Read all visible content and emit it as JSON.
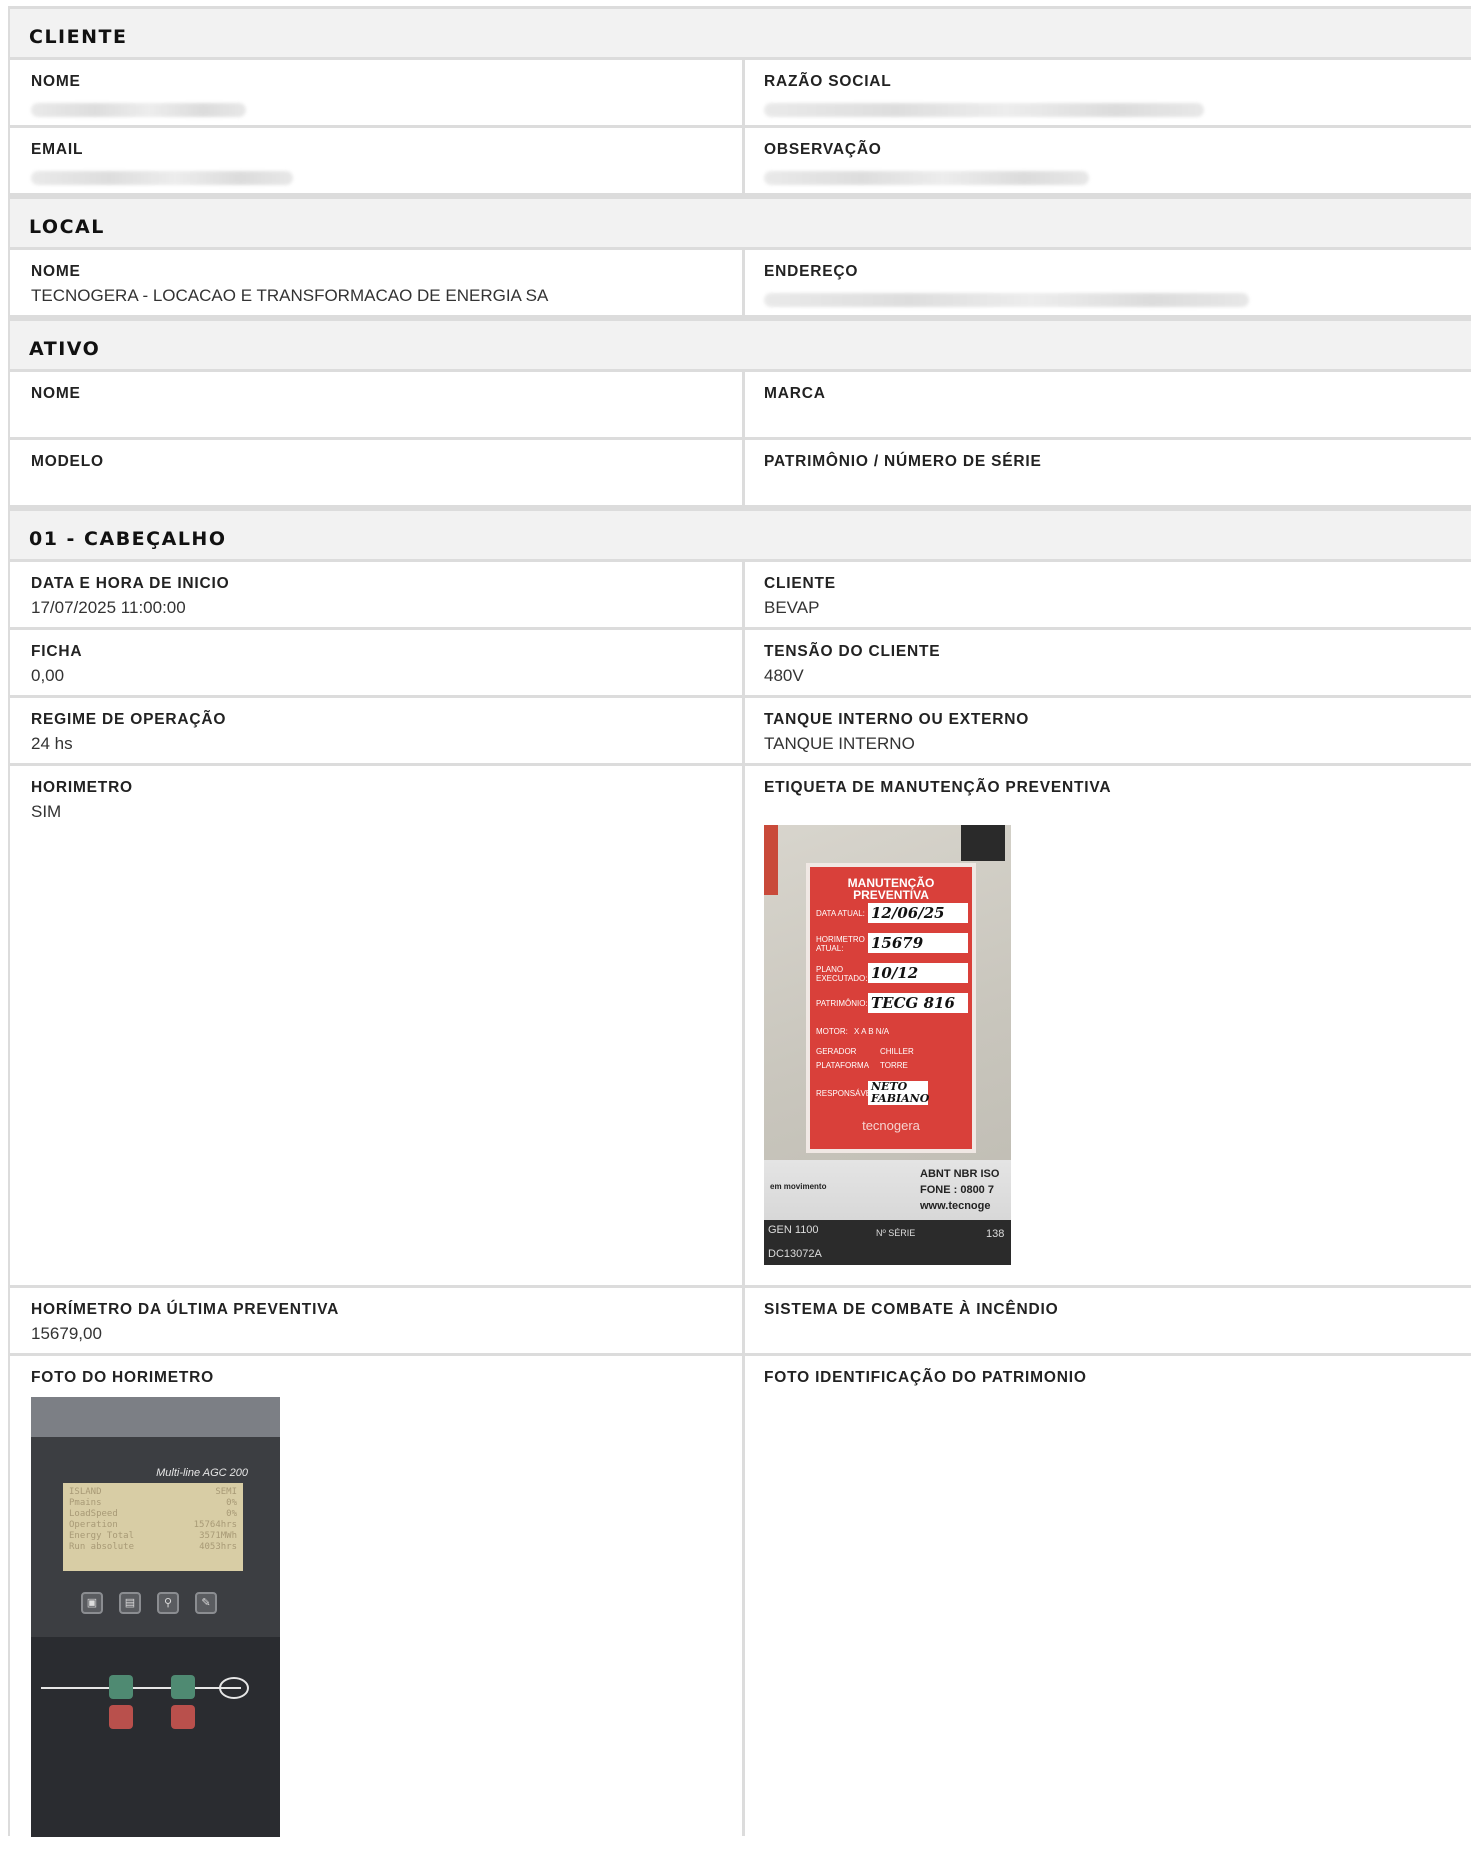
{
  "sections": {
    "cliente": {
      "title": "CLIENTE",
      "nome_label": "NOME",
      "razao_label": "RAZÃO SOCIAL",
      "email_label": "EMAIL",
      "observacao_label": "OBSERVAÇÃO"
    },
    "local": {
      "title": "LOCAL",
      "nome_label": "NOME",
      "nome_value": "TECNOGERA - LOCACAO E TRANSFORMACAO DE ENERGIA SA",
      "endereco_label": "ENDEREÇO"
    },
    "ativo": {
      "title": "ATIVO",
      "nome_label": "NOME",
      "marca_label": "MARCA",
      "modelo_label": "MODELO",
      "patrimonio_label": "PATRIMÔNIO / NÚMERO DE SÉRIE"
    },
    "cabecalho": {
      "title": "01 - CABEÇALHO",
      "data_label": "DATA E HORA DE INICIO",
      "data_value": "17/07/2025 11:00:00",
      "cliente_label": "CLIENTE",
      "cliente_value": "BEVAP",
      "ficha_label": "FICHA",
      "ficha_value": "0,00",
      "tensao_label": "TENSÃO DO CLIENTE",
      "tensao_value": "480V",
      "regime_label": "REGIME DE OPERAÇÃO",
      "regime_value": "24 hs",
      "tanque_label": "TANQUE INTERNO OU EXTERNO",
      "tanque_value": "TANQUE INTERNO",
      "horimetro_label": "HORIMETRO",
      "horimetro_value": "SIM",
      "etiqueta_label": "ETIQUETA DE MANUTENÇÃO PREVENTIVA",
      "horimetro_ultima_label": "HORÍMETRO DA ÚLTIMA PREVENTIVA",
      "horimetro_ultima_value": "15679,00",
      "sistema_label": "SISTEMA DE COMBATE À INCÊNDIO",
      "foto_horimetro_label": "FOTO DO HORIMETRO",
      "foto_patrimonio_label": "FOTO IDENTIFICAÇÃO DO PATRIMONIO"
    }
  },
  "tag_photo": {
    "title": "MANUTENÇÃO PREVENTIVA",
    "data_atual_label": "DATA ATUAL:",
    "data_atual": "12/06/25",
    "horimetro_label": "HORIMETRO ATUAL:",
    "horimetro": "15679",
    "plano_label": "PLANO EXECUTADO:",
    "plano": "10/12",
    "patrimonio_label": "PATRIMÔNIO:",
    "patrimonio": "TECG 816",
    "motor_label": "MOTOR:",
    "motor_opts": "X A   B   N/A",
    "gerador": "GERADOR",
    "chiller": "CHILLER",
    "plataforma": "PLATAFORMA",
    "torre": "TORRE",
    "responsavel_label": "RESPONSÁVEL:",
    "responsavel": "NETO FABIANO",
    "brand": "tecnogera",
    "plate_norm": "ABNT NBR ISO",
    "plate_fone": "FONE : 0800 7",
    "plate_site": "www.tecnoge",
    "plate_slogan": "em movimento",
    "plate_model": "GEN 1100",
    "plate_serie": "Nº SÉRIE",
    "plate_serie_val": "138",
    "plate_code": "DC13072A"
  },
  "hm_photo": {
    "brand": "Multi-line AGC 200",
    "lcd_rows": [
      [
        "ISLAND",
        "SEMI"
      ],
      [
        "Pmains",
        "0%"
      ],
      [
        "LoadSpeed",
        "0%"
      ],
      [
        "Operation",
        "15764hrs"
      ],
      [
        "Energy Total",
        "3571MWh"
      ],
      [
        "Run absolute",
        "4053hrs"
      ]
    ]
  }
}
